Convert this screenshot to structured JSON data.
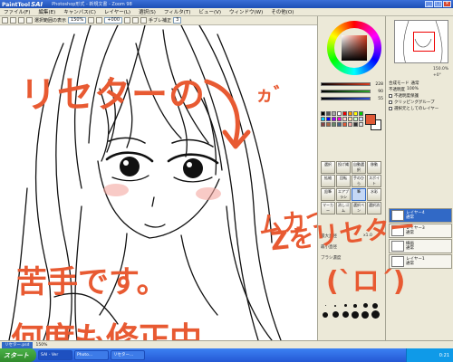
{
  "window": {
    "app_name": "SAI",
    "app_prefix": "PaintTool",
    "title": "Photoshop形式 - 新規文書 - Zoom 98",
    "buttons": [
      "_",
      "□",
      "×"
    ]
  },
  "menu": [
    "ファイル(F)",
    "編集(E)",
    "キャンバス(C)",
    "レイヤー(L)",
    "選択(S)",
    "フィルタ(T)",
    "ビュー(V)",
    "ウィンドウ(W)",
    "その他(O)"
  ],
  "toolbar": {
    "selection_label": "選択範囲の表示",
    "zoom": "150%",
    "angle": "+000",
    "correction_label": "手ブレ補正",
    "correction_value": "3"
  },
  "color": {
    "foreground": "#e05a36",
    "background": "#ffffff",
    "sliders": [
      {
        "color": "#d93a1c",
        "value": "228"
      },
      {
        "color": "#2aa52a",
        "value": "90"
      },
      {
        "color": "#2a4fd9",
        "value": "55"
      }
    ]
  },
  "tools": [
    "選択",
    "投げ縄",
    "自動選択",
    "移動",
    "拡縮",
    "回転",
    "手のひら",
    "スポイト",
    "鉛筆",
    "エアブラシ",
    "筆",
    "水彩",
    "マーカー",
    "消しゴム",
    "選択ペン",
    "選択消"
  ],
  "brush": {
    "size_label": "最大直径",
    "size_value": "x1.0",
    "min_label": "最小直径",
    "density_label": "ブラシ濃度"
  },
  "navigator": {
    "zoom": "150.0%",
    "angle": "+0°"
  },
  "layer_panel": {
    "mode_label": "合成モード",
    "mode_value": "通常",
    "opacity_label": "不透明度",
    "opacity_value": "100%",
    "options": [
      "不透明度保護",
      "クリッピンググループ",
      "選択元としてのレイヤー"
    ],
    "layers": [
      {
        "name": "レイヤー4",
        "mode": "通常"
      },
      {
        "name": "レイヤー3",
        "mode": "通常"
      },
      {
        "name": "線画",
        "mode": "通常"
      },
      {
        "name": "レイヤー1",
        "mode": "通常"
      }
    ]
  },
  "status": {
    "document": "リセター.psd",
    "zoom": "150%"
  },
  "taskbar": {
    "start": "スタート",
    "tasks": [
      "SAI - Ver",
      "Photo...",
      "リセター..."
    ],
    "clock": "0:21"
  },
  "overlay_text": {
    "line1": "リセターの",
    "arrow_note": "ヵ゛",
    "line2": "苦手です。",
    "line3": "何度も修正中。。。",
    "line4": "ムカついたので",
    "line5": "Zをリセター",
    "face": "(`ロ´)"
  }
}
